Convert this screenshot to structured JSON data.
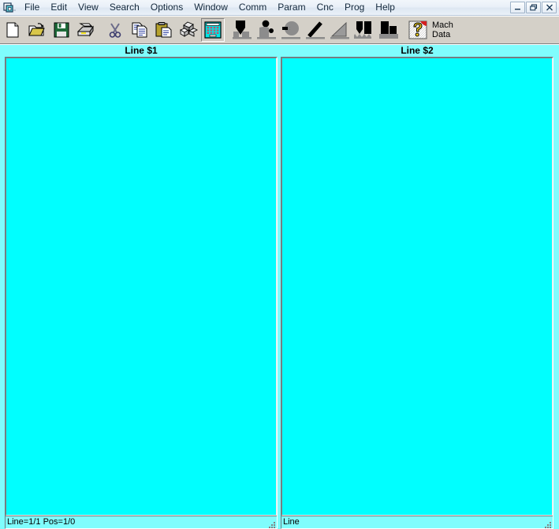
{
  "window": {
    "app_icon": "cnc-app-icon",
    "controls": {
      "minimize": "minimize-button",
      "restore": "restore-button",
      "close": "close-button"
    }
  },
  "menubar": {
    "items": [
      {
        "label": "File"
      },
      {
        "label": "Edit"
      },
      {
        "label": "View"
      },
      {
        "label": "Search"
      },
      {
        "label": "Options"
      },
      {
        "label": "Window"
      },
      {
        "label": "Comm"
      },
      {
        "label": "Param"
      },
      {
        "label": "Cnc"
      },
      {
        "label": "Prog"
      },
      {
        "label": "Help"
      }
    ]
  },
  "toolbar": {
    "buttons": [
      {
        "name": "new-file-icon",
        "tooltip": "New",
        "pressed": false
      },
      {
        "name": "open-folder-icon",
        "tooltip": "Open",
        "pressed": false
      },
      {
        "name": "save-floppy-icon",
        "tooltip": "Save",
        "pressed": false
      },
      {
        "name": "print-icon",
        "tooltip": "Print",
        "pressed": false
      },
      {
        "name": "cut-scissors-icon",
        "tooltip": "Cut",
        "pressed": false
      },
      {
        "name": "copy-icon",
        "tooltip": "Copy",
        "pressed": false
      },
      {
        "name": "paste-clipboard-icon",
        "tooltip": "Paste",
        "pressed": false
      },
      {
        "name": "blocks-3d-icon",
        "tooltip": "Blocks",
        "pressed": false
      },
      {
        "name": "calculator-icon",
        "tooltip": "Calculator",
        "pressed": true
      },
      {
        "name": "drill-tool-icon",
        "tooltip": "Drill",
        "pressed": false
      },
      {
        "name": "tap-tool-icon",
        "tooltip": "Tap",
        "pressed": false
      },
      {
        "name": "bore-circle-icon",
        "tooltip": "Bore",
        "pressed": false
      },
      {
        "name": "chamfer-line-icon",
        "tooltip": "Chamfer",
        "pressed": false
      },
      {
        "name": "taper-triangle-icon",
        "tooltip": "Taper",
        "pressed": false
      },
      {
        "name": "groove-profile-icon",
        "tooltip": "Groove",
        "pressed": false
      },
      {
        "name": "pocket-profile-icon",
        "tooltip": "Pocket",
        "pressed": false
      },
      {
        "name": "help-question-icon",
        "tooltip": "Machine Data",
        "pressed": false
      }
    ],
    "mach_data_label": "Mach\nData"
  },
  "panes": [
    {
      "title": "Line $1",
      "content": "",
      "status": "Line=1/1 Pos=1/0",
      "bg_color": "#00ffff"
    },
    {
      "title": "Line $2",
      "content": "",
      "status": "Line",
      "bg_color": "#00ffff"
    }
  ],
  "colors": {
    "editor_bg": "#00ffff",
    "workspace_bg": "#7ffdfd",
    "toolbar_bg": "#d4d0c8",
    "titlebar_bg": "#eaf1f8"
  }
}
